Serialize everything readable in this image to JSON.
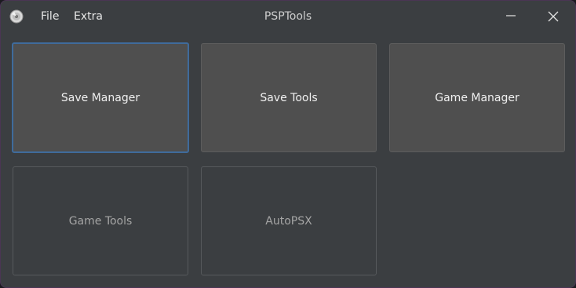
{
  "window": {
    "title": "PSPTools",
    "app_icon": "psp-disc-icon"
  },
  "menu": {
    "file": "File",
    "extra": "Extra"
  },
  "controls": {
    "minimize_icon": "minimize-icon",
    "close_icon": "close-icon"
  },
  "tiles": {
    "save_manager": {
      "label": "Save Manager",
      "enabled": true,
      "focused": true
    },
    "save_tools": {
      "label": "Save Tools",
      "enabled": true
    },
    "game_manager": {
      "label": "Game Manager",
      "enabled": true
    },
    "game_tools": {
      "label": "Game Tools",
      "enabled": false
    },
    "autopsx": {
      "label": "AutoPSX",
      "enabled": false
    }
  },
  "colors": {
    "background": "#3b3e41",
    "tile_enabled": "#4f4f4f",
    "focus_border": "#3f6b9c",
    "window_border": "#4a3554"
  }
}
